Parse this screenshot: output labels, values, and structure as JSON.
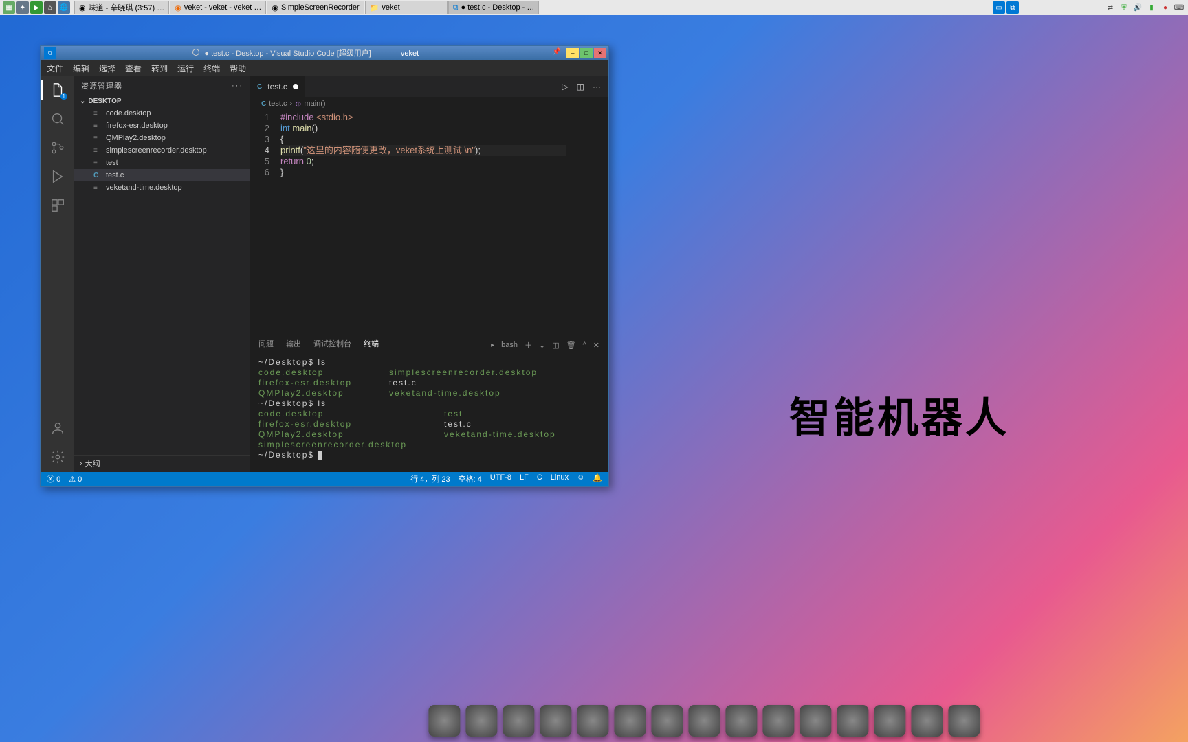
{
  "taskbar": {
    "tabs": [
      {
        "label": "味道 - 辛晓琪 (3:57) …"
      },
      {
        "label": "veket - veket - veket …"
      },
      {
        "label": "SimpleScreenRecorder"
      },
      {
        "label": "veket"
      },
      {
        "label": "● test.c - Desktop - …"
      }
    ]
  },
  "desktop_text": "智能机器人",
  "window": {
    "title": "● test.c - Desktop - Visual Studio Code [超级用户]",
    "title_suffix": "veket"
  },
  "menu": [
    "文件",
    "编辑",
    "选择",
    "查看",
    "转到",
    "运行",
    "终端",
    "帮助"
  ],
  "explorer": {
    "title": "资源管理器",
    "section": "DESKTOP",
    "outline": "大纲",
    "files": [
      {
        "name": "code.desktop"
      },
      {
        "name": "firefox-esr.desktop"
      },
      {
        "name": "QMPlay2.desktop"
      },
      {
        "name": "simplescreenrecorder.desktop"
      },
      {
        "name": "test"
      },
      {
        "name": "test.c",
        "active": true,
        "icon": "C"
      },
      {
        "name": "veketand-time.desktop"
      }
    ]
  },
  "editor": {
    "tab": "test.c",
    "crumb_file": "test.c",
    "crumb_symbol": "main()",
    "code": {
      "l1_include": "#include",
      "l1_h": " <stdio.h>",
      "l2_int": "int",
      "l2_main": " main",
      "l2_paren": "()",
      "l3": "{",
      "l4_fn": "printf",
      "l4_p1": "(",
      "l4_s": "\"这里的内容随便更改，veket系统上测试 \\n\"",
      "l4_p2": ");",
      "l5_ret": "return ",
      "l5_num": "0",
      "l5_semi": ";",
      "l6": "}"
    }
  },
  "panel": {
    "tabs": [
      "问题",
      "输出",
      "调试控制台",
      "终端"
    ],
    "shell": "bash",
    "terminal": {
      "p1": "~/Desktop$ ls",
      "r1a": "code.desktop",
      "r1b": "simplescreenrecorder.desktop",
      "r2a": "firefox-esr.desktop",
      "r2b": "test.c",
      "r3a": "QMPlay2.desktop",
      "r3b": "veketand-time.desktop",
      "p2": "~/Desktop$ ls",
      "r4a": "code.desktop",
      "r4b": "test",
      "r5a": "firefox-esr.desktop",
      "r5b": "test.c",
      "r6a": "QMPlay2.desktop",
      "r6b": "veketand-time.desktop",
      "r7a": "simplescreenrecorder.desktop",
      "p3": "~/Desktop$ "
    }
  },
  "status": {
    "errors": "0",
    "warnings": "0",
    "pos": "行 4，列 23",
    "spaces": "空格: 4",
    "enc": "UTF-8",
    "eol": "LF",
    "lang": "C",
    "os": "Linux"
  }
}
